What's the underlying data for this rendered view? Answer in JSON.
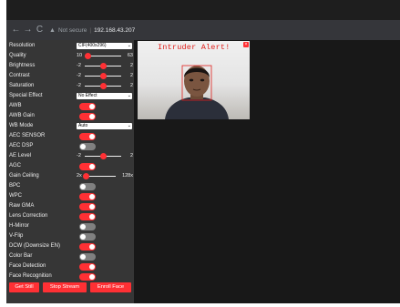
{
  "browser": {
    "security_label": "Not secure",
    "url": "192.168.43.207"
  },
  "settings": {
    "resolution": {
      "label": "Resolution",
      "value": "CIF(400x296)"
    },
    "quality": {
      "label": "Quality",
      "min": "10",
      "max": "63",
      "value": 15
    },
    "brightness": {
      "label": "Brightness",
      "min": "-2",
      "max": "2",
      "value": 0
    },
    "contrast": {
      "label": "Contrast",
      "min": "-2",
      "max": "2",
      "value": 0
    },
    "saturation": {
      "label": "Saturation",
      "min": "-2",
      "max": "2",
      "value": 0
    },
    "special_effect": {
      "label": "Special Effect",
      "value": "No Effect"
    },
    "awb": {
      "label": "AWB",
      "on": true
    },
    "awb_gain": {
      "label": "AWB Gain",
      "on": true
    },
    "wb_mode": {
      "label": "WB Mode",
      "value": "Auto"
    },
    "aec_sensor": {
      "label": "AEC SENSOR",
      "on": true
    },
    "aec_dsp": {
      "label": "AEC DSP",
      "on": false
    },
    "ae_level": {
      "label": "AE Level",
      "min": "-2",
      "max": "2",
      "value": 0
    },
    "agc": {
      "label": "AGC",
      "on": true
    },
    "gain_ceiling": {
      "label": "Gain Ceiling",
      "min": "2x",
      "max": "128x",
      "value": 0
    },
    "bpc": {
      "label": "BPC",
      "on": false
    },
    "wpc": {
      "label": "WPC",
      "on": true
    },
    "raw_gma": {
      "label": "Raw GMA",
      "on": true
    },
    "lens_correction": {
      "label": "Lens Correction",
      "on": true
    },
    "h_mirror": {
      "label": "H-Mirror",
      "on": false
    },
    "v_flip": {
      "label": "V-Flip",
      "on": false
    },
    "dcw": {
      "label": "DCW (Downsize EN)",
      "on": true
    },
    "color_bar": {
      "label": "Color Bar",
      "on": false
    },
    "face_detection": {
      "label": "Face Detection",
      "on": true
    },
    "face_recognition": {
      "label": "Face Recognition",
      "on": true
    }
  },
  "buttons": {
    "get_still": "Get Still",
    "stop_stream": "Stop Stream",
    "enroll_face": "Enroll Face"
  },
  "stream": {
    "alert_text": "Intruder Alert!",
    "close_symbol": "×"
  },
  "icons": {
    "back": "back-arrow-icon",
    "forward": "forward-arrow-icon",
    "reload": "reload-icon",
    "warning": "warning-triangle-icon",
    "select_chevron": "chevron-down-icon"
  },
  "colors": {
    "accent": "#ff3034",
    "sidebar_bg": "#363636",
    "page_bg": "#181818",
    "toggle_off": "#808080"
  }
}
